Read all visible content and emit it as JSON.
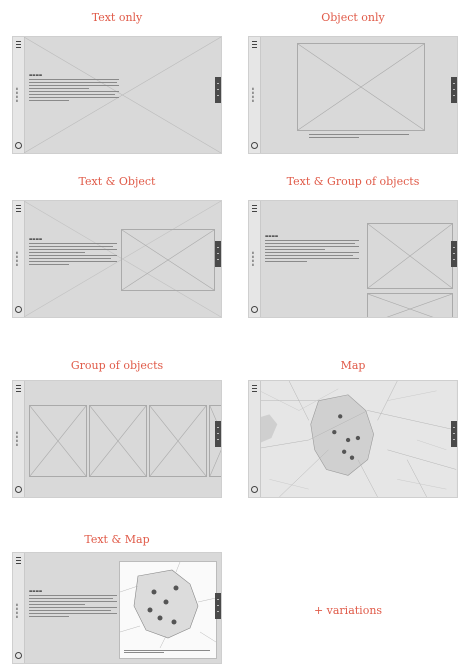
{
  "panels": [
    {
      "title": "Text only"
    },
    {
      "title": "Object only"
    },
    {
      "title": "Text & Object"
    },
    {
      "title": "Text & Group of objects"
    },
    {
      "title": "Group of objects"
    },
    {
      "title": "Map"
    },
    {
      "title": "Text & Map"
    }
  ],
  "footer": {
    "variations": "+ variations"
  },
  "colors": {
    "title": "#e05a48",
    "frame": "#d9d9d9",
    "rail": "#e6e6e6"
  },
  "icons": [
    "menu-icon",
    "nav-circle-icon",
    "close-x-icon",
    "map-pin-icon"
  ]
}
